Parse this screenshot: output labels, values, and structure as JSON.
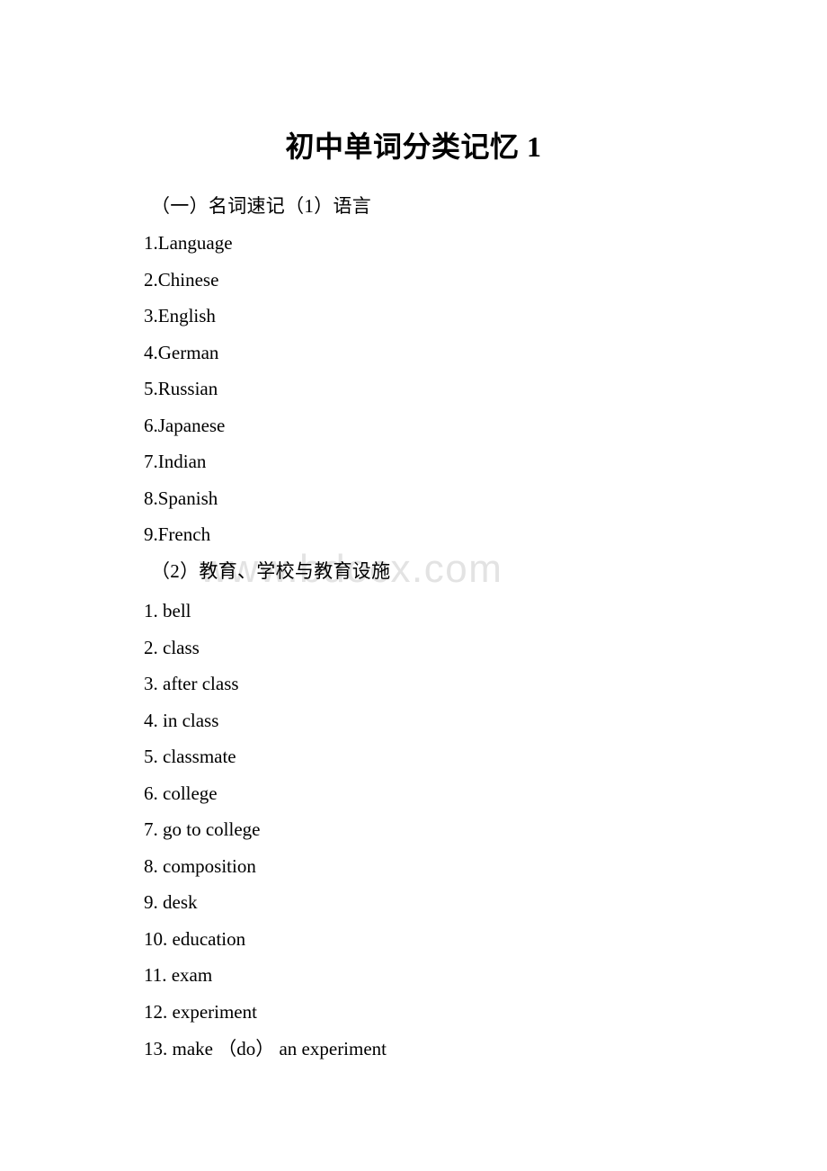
{
  "document": {
    "title": "初中单词分类记忆 1",
    "watermark": "www.bdocx.com",
    "watermark_color": "#e3e3e3",
    "text_color": "#000000",
    "background_color": "#ffffff"
  },
  "sections": [
    {
      "heading": "（一）名词速记（1）语言",
      "items": [
        "1.Language",
        "2.Chinese",
        "3.English",
        "4.German",
        "5.Russian",
        "6.Japanese",
        "7.Indian",
        "8.Spanish",
        "9.French"
      ]
    },
    {
      "heading": "（2）教育、学校与教育设施",
      "items": [
        "1. bell",
        "2. class",
        "3. after class",
        "4. in class",
        "5. classmate",
        "6. college",
        "7. go to college",
        "8. composition",
        "9. desk",
        "10. education",
        "11. exam",
        "12. experiment",
        "13. make （do） an experiment"
      ]
    }
  ]
}
